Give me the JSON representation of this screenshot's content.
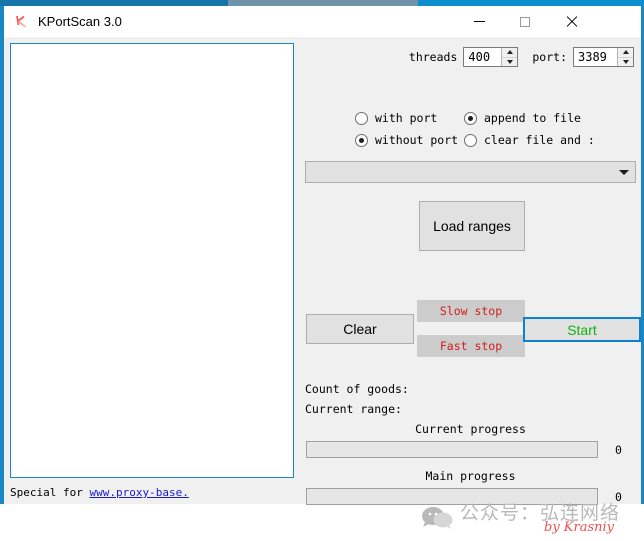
{
  "window": {
    "title": "KPortScan 3.0",
    "icon": "k-logo-icon",
    "minimize_label": "—",
    "maximize_label": "□",
    "close_label": "✕"
  },
  "results": {
    "content": "",
    "placeholder": ""
  },
  "statusbar": {
    "prefix": "Special for ",
    "link_text": "www.proxy-base."
  },
  "settings": {
    "threads_label": "threads",
    "threads_value": "400",
    "port_label": "port:",
    "port_value": "3389"
  },
  "radios": {
    "with_port": {
      "label": "with port",
      "checked": false
    },
    "without_port": {
      "label": "without port",
      "checked": true
    },
    "append_to_file": {
      "label": "append to file",
      "checked": true
    },
    "clear_file": {
      "label": "clear file and :",
      "checked": false
    }
  },
  "combo": {
    "value": "",
    "arrow_icon": "chevron-down-icon"
  },
  "buttons": {
    "load_ranges": "Load ranges",
    "clear": "Clear",
    "slow_stop": "Slow stop",
    "fast_stop": "Fast stop",
    "start": "Start"
  },
  "info": {
    "count_of_goods": "Count of goods:",
    "current_range": "Current range:"
  },
  "progress": {
    "current_caption": "Current progress",
    "current_value": "0",
    "current_percent": 0,
    "main_caption": "Main progress",
    "main_value": "0",
    "main_percent": 0
  },
  "watermark": {
    "text": "公众号：弘连网络",
    "byline": "by Krasniy",
    "icon": "wechat-icon"
  },
  "colors": {
    "accent_blue": "#1887c4",
    "start_green": "#13b013",
    "stop_red": "#d21c1c",
    "link_blue": "#1919d0",
    "watermark_grey": "#b9b9b9",
    "byline_red": "#e8524f"
  }
}
